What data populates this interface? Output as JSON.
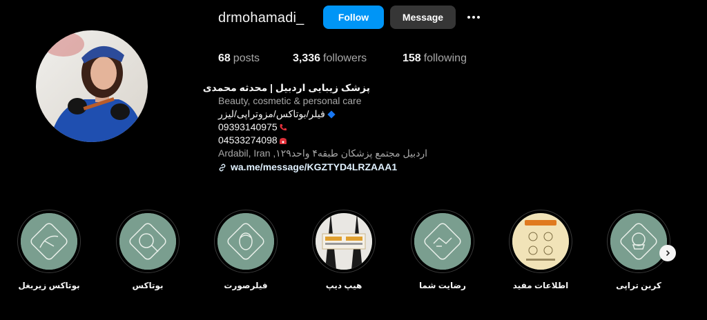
{
  "profile": {
    "username": "drmohamadi_",
    "follow_label": "Follow",
    "message_label": "Message",
    "stats": {
      "posts_count": "68",
      "posts_label": "posts",
      "followers_count": "3,336",
      "followers_label": "followers",
      "following_count": "158",
      "following_label": "following"
    },
    "bio": {
      "name": "پزشک زیبایی اردبیل | محدثه محمدی",
      "category": "Beauty, cosmetic & personal care",
      "services": "فیلر/بوتاکس/مزوتراپی/لیزر",
      "mobile": "09393140975",
      "phone": "04533274098",
      "address": "Ardabil, Iran ,اردبیل مجتمع پزشکان طبقه۴ واحد۱۲۹",
      "link": "wa.me/message/KGZTYD4LRZAAA1"
    }
  },
  "highlights": [
    {
      "label": "بوتاکس زیربغل",
      "icon": "armpit-icon"
    },
    {
      "label": "بوتاکس",
      "icon": "face-injection-icon"
    },
    {
      "label": "فیلرصورت",
      "icon": "face-filler-icon"
    },
    {
      "label": "هیپ دیپ",
      "icon": "hip-dip-photo"
    },
    {
      "label": "رضایت شما",
      "icon": "handshake-icon"
    },
    {
      "label": "اطلاعات مفید",
      "icon": "info-poster"
    },
    {
      "label": "کربن تراپی",
      "icon": "carbon-therapy-icon"
    }
  ],
  "colors": {
    "accent": "#0095f6",
    "highlight_bg": "#7a9e8f",
    "secondary_button": "#363636"
  }
}
